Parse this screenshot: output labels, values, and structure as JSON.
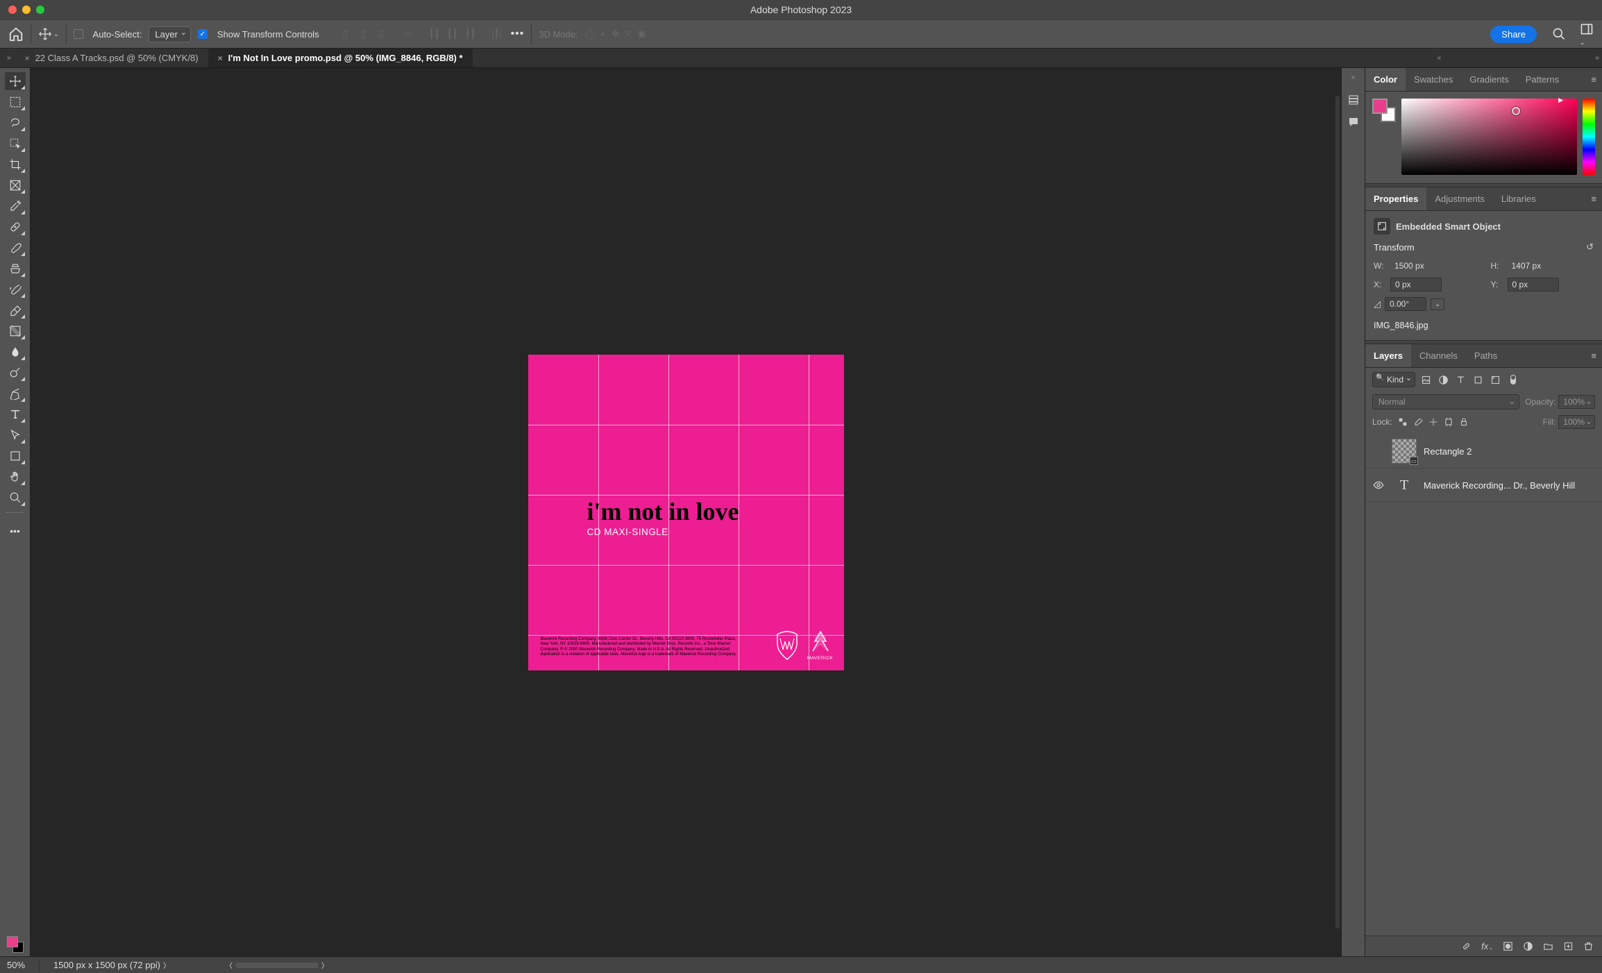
{
  "app_title": "Adobe Photoshop 2023",
  "options": {
    "auto_select_label": "Auto-Select:",
    "layer_select": "Layer",
    "show_transform_label": "Show Transform Controls",
    "threed_label": "3D Mode:",
    "share": "Share"
  },
  "tabs": [
    {
      "label": "22 Class A Tracks.psd @ 50% (CMYK/8)",
      "active": false
    },
    {
      "label": "I'm Not In Love promo.psd @ 50% (IMG_8846, RGB/8) *",
      "active": true
    }
  ],
  "artwork": {
    "title": "i'm not in love",
    "subtitle": "CD MAXI-SINGLE",
    "fineprint": "Maverick Recording Company, 9348 Civic Center Dr., Beverly Hills, CA 90210-3606. 75 Rockefeller Plaza, New York, NY 10019-6908. Manufactured and distributed by Warner Bros. Records Inc., a Time Warner Company. ® © 2000 Maverick Recording Company. Made in U.S.A. All Rights Reserved. Unauthorized duplication is a violation of applicable laws. Maverick logo is a trademark of Maverick Recording Company.",
    "logo2_label": "MAVERICK"
  },
  "panels": {
    "color": {
      "tabs": [
        "Color",
        "Swatches",
        "Gradients",
        "Patterns"
      ]
    },
    "properties": {
      "tabs": [
        "Properties",
        "Adjustments",
        "Libraries"
      ],
      "object_type": "Embedded Smart Object",
      "transform_label": "Transform",
      "w_label": "W:",
      "w_value": "1500 px",
      "h_label": "H:",
      "h_value": "1407 px",
      "x_label": "X:",
      "x_value": "0 px",
      "y_label": "Y:",
      "y_value": "0 px",
      "rot_value": "0.00°",
      "filename": "IMG_8846.jpg"
    },
    "layers": {
      "tabs": [
        "Layers",
        "Channels",
        "Paths"
      ],
      "kind_label": "Kind",
      "blend_mode": "Normal",
      "opacity_label": "Opacity:",
      "opacity_value": "100%",
      "lock_label": "Lock:",
      "fill_label": "Fill:",
      "fill_value": "100%",
      "items": [
        {
          "name": "Rectangle 2",
          "visible": false,
          "type": "shape"
        },
        {
          "name": "Maverick Recording... Dr., Beverly Hill",
          "visible": true,
          "type": "text"
        }
      ]
    }
  },
  "status": {
    "zoom": "50%",
    "doc_info": "1500 px x 1500 px (72 ppi)"
  },
  "colors": {
    "accent": "#1473e6",
    "canvas_pink": "#ed1e91",
    "foreground": "#e83e8c"
  }
}
